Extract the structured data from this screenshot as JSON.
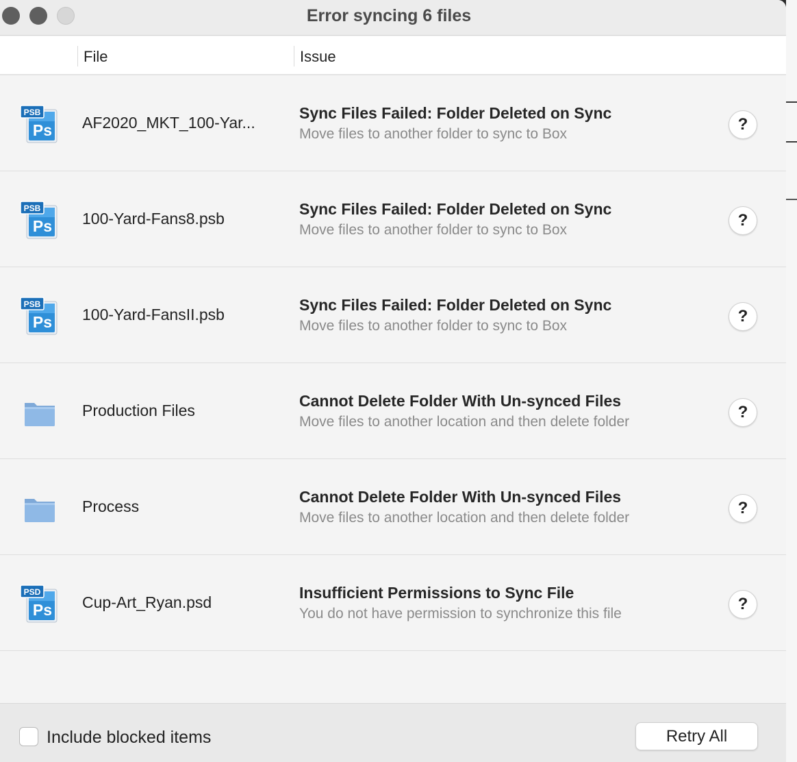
{
  "window": {
    "title": "Error syncing 6 files"
  },
  "columns": {
    "file": "File",
    "issue": "Issue"
  },
  "rows": [
    {
      "icon": "psb-photoshop-icon",
      "icon_tag": "PSB",
      "icon_label": "Ps",
      "file": "AF2020_MKT_100-Yar...",
      "issue_title": "Sync Files Failed: Folder Deleted on Sync",
      "issue_sub": "Move files to another folder to sync to Box",
      "help": "?"
    },
    {
      "icon": "psb-photoshop-icon",
      "icon_tag": "PSB",
      "icon_label": "Ps",
      "file": "100-Yard-Fans8.psb",
      "issue_title": "Sync Files Failed: Folder Deleted on Sync",
      "issue_sub": "Move files to another folder to sync to Box",
      "help": "?"
    },
    {
      "icon": "psb-photoshop-icon",
      "icon_tag": "PSB",
      "icon_label": "Ps",
      "file": "100-Yard-FansII.psb",
      "issue_title": "Sync Files Failed: Folder Deleted on Sync",
      "issue_sub": "Move files to another folder to sync to Box",
      "help": "?"
    },
    {
      "icon": "folder-icon",
      "file": "Production Files",
      "issue_title": "Cannot Delete Folder With Un-synced Files",
      "issue_sub": "Move files to another location and then delete folder",
      "help": "?"
    },
    {
      "icon": "folder-icon",
      "file": "Process",
      "issue_title": "Cannot Delete Folder With Un-synced Files",
      "issue_sub": "Move files to another location and then delete folder",
      "help": "?"
    },
    {
      "icon": "psd-photoshop-icon",
      "icon_tag": "PSD",
      "icon_label": "Ps",
      "file": "Cup-Art_Ryan.psd",
      "issue_title": "Insufficient Permissions to Sync File",
      "issue_sub": "You do not have permission to synchronize this file",
      "help": "?"
    }
  ],
  "footer": {
    "include_blocked_label": "Include blocked items",
    "include_blocked_checked": false,
    "retry_label": "Retry All"
  },
  "colors": {
    "ps_blue": "#2f8fd8",
    "ps_tag": "#1b6fb8",
    "folder": "#8fb9e6"
  }
}
